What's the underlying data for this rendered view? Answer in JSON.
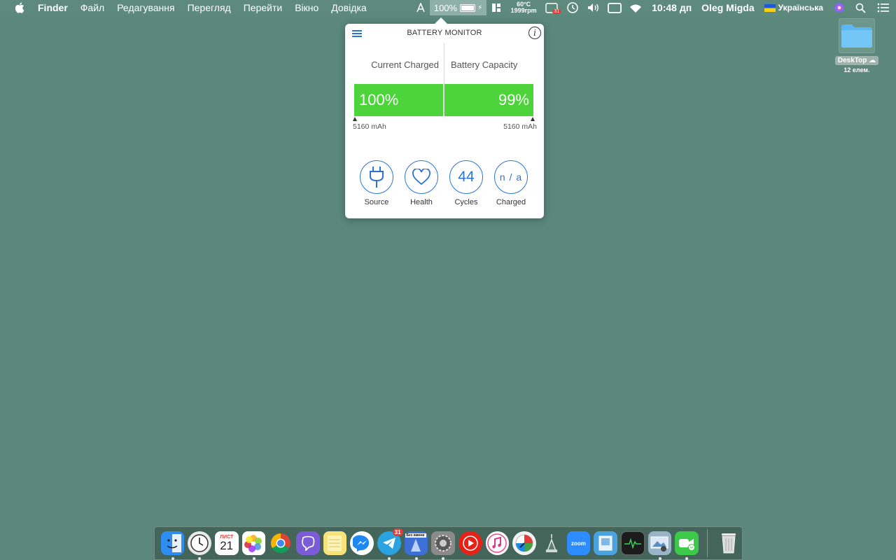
{
  "menubar": {
    "app_name": "Finder",
    "menus": [
      "Файл",
      "Редагування",
      "Перегляд",
      "Перейти",
      "Вікно",
      "Довідка"
    ],
    "battery_percent": "100%",
    "temp": "60°C",
    "fan": "1999rpm",
    "calendar_badge": "31",
    "time": "10:48 дп",
    "user": "Oleg Migda",
    "language": "Українська"
  },
  "popover": {
    "title": "BATTERY MONITOR",
    "info_glyph": "i",
    "current_charged_label": "Current Charged",
    "battery_capacity_label": "Battery Capacity",
    "current_charged_value": "100%",
    "battery_capacity_value": "99%",
    "current_mah": "5160 mAh",
    "capacity_mah": "5160 mAh",
    "stats": {
      "source_label": "Source",
      "health_label": "Health",
      "cycles_value": "44",
      "cycles_label": "Cycles",
      "charged_value": "n / a",
      "charged_label": "Charged"
    }
  },
  "desktop": {
    "folder_name": "DeskTop",
    "folder_count": "12 елем."
  },
  "dock": {
    "calendar_month": "ЛИСТ",
    "calendar_day": "21",
    "telegram_badge": "31",
    "zoom_label": "zoom",
    "sketch_label": "Без имени",
    "items": [
      {
        "name": "finder",
        "color": "#2f8cf0"
      },
      {
        "name": "clock",
        "color": "#f2f2f2"
      },
      {
        "name": "calendar",
        "color": "#ffffff"
      },
      {
        "name": "photos",
        "color": "#ffffff"
      },
      {
        "name": "chrome",
        "color": "#ffffff"
      },
      {
        "name": "viber",
        "color": "#7b5cd6"
      },
      {
        "name": "notes",
        "color": "#f7e37a"
      },
      {
        "name": "messenger",
        "color": "#ffffff"
      },
      {
        "name": "telegram",
        "color": "#2aa3e0"
      },
      {
        "name": "sketch",
        "color": "#3d6fd6"
      },
      {
        "name": "system-preferences",
        "color": "#8a8a8a"
      },
      {
        "name": "youtube",
        "color": "#e62117"
      },
      {
        "name": "itunes",
        "color": "#ffffff"
      },
      {
        "name": "disk-diag",
        "color": "#f2f2f2"
      },
      {
        "name": "automator",
        "color": "#5d8a7d"
      },
      {
        "name": "zoom",
        "color": "#2d8cff"
      },
      {
        "name": "preview",
        "color": "#4aa3df"
      },
      {
        "name": "activity-monitor",
        "color": "#1b1b1b"
      },
      {
        "name": "image-capture",
        "color": "#9bb3c7"
      },
      {
        "name": "facetime",
        "color": "#3cc94a"
      }
    ]
  }
}
